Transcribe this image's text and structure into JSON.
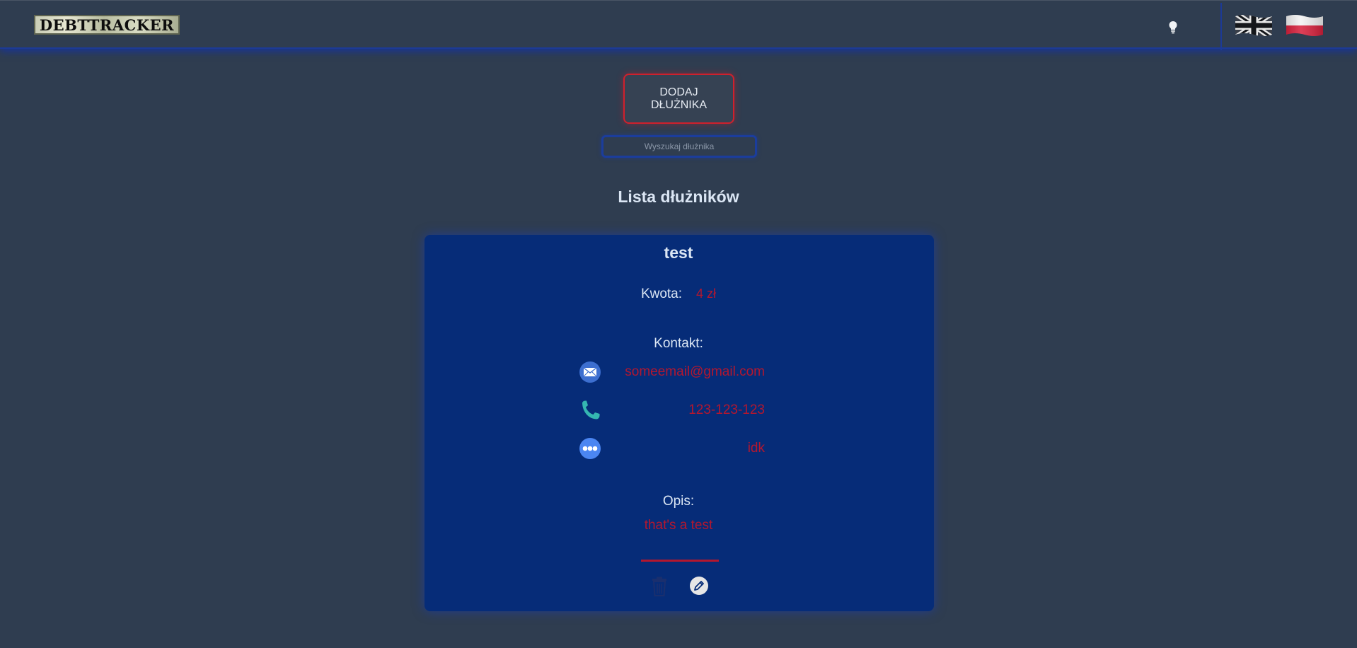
{
  "header": {
    "logo_text": "DebtTracker",
    "theme_toggle_icon": "lightbulb-icon",
    "languages": [
      {
        "code": "en",
        "icon": "uk-flag-icon"
      },
      {
        "code": "pl",
        "icon": "poland-flag-icon"
      }
    ]
  },
  "main": {
    "add_button_label": "DODAJ DŁUŻNIKA",
    "search_placeholder": "Wyszukaj dłużnika",
    "list_title": "Lista dłużników"
  },
  "debtors": [
    {
      "name": "test",
      "amount_label": "Kwota:",
      "amount_value": "4 zł",
      "contact_label": "Kontakt:",
      "email": "someemail@gmail.com",
      "phone": "123-123-123",
      "other": "idk",
      "description_label": "Opis:",
      "description": "that's a test"
    }
  ],
  "colors": {
    "background": "#2f3d50",
    "card": "#062c78",
    "accent_red": "#b3172f",
    "accent_blue": "#1c3a96"
  }
}
